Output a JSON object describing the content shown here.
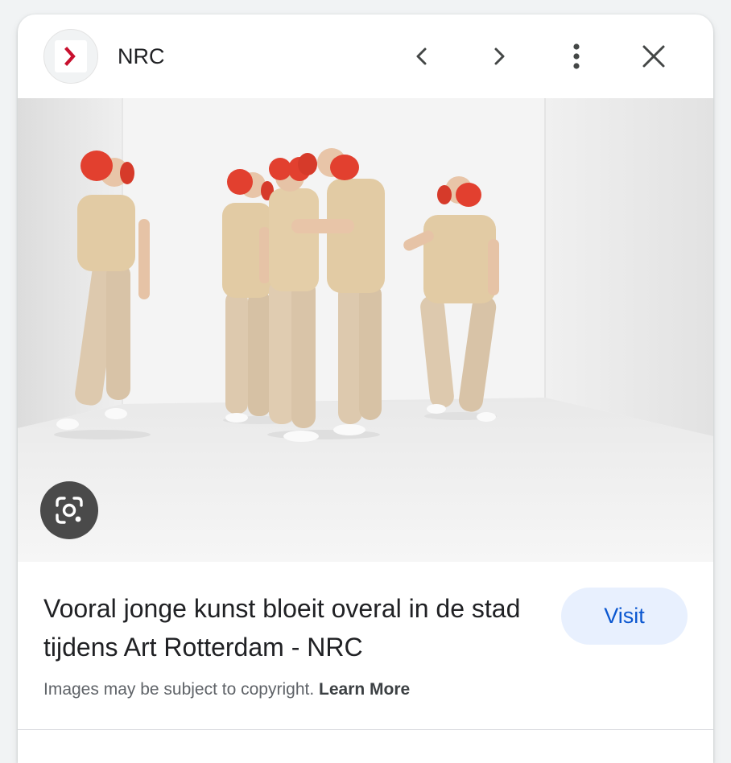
{
  "header": {
    "site_name": "NRC",
    "favicon_icon": "nrc-chevron-logo",
    "prev_icon": "chevron-left-icon",
    "next_icon": "chevron-right-icon",
    "more_icon": "more-vert-icon",
    "close_icon": "close-icon"
  },
  "image": {
    "lens_icon": "google-lens-icon"
  },
  "result": {
    "title": "Vooral jonge kunst bloeit overal in de stad tijdens Art Rotterdam - NRC",
    "visit_label": "Visit",
    "copyright_text": "Images may be subject to copyright.",
    "learn_more_label": "Learn More"
  },
  "colors": {
    "accent": "#0b57d0",
    "visit_bg": "#e8f0fe",
    "brand_red": "#c8102e",
    "headphone_red": "#e2402f"
  }
}
